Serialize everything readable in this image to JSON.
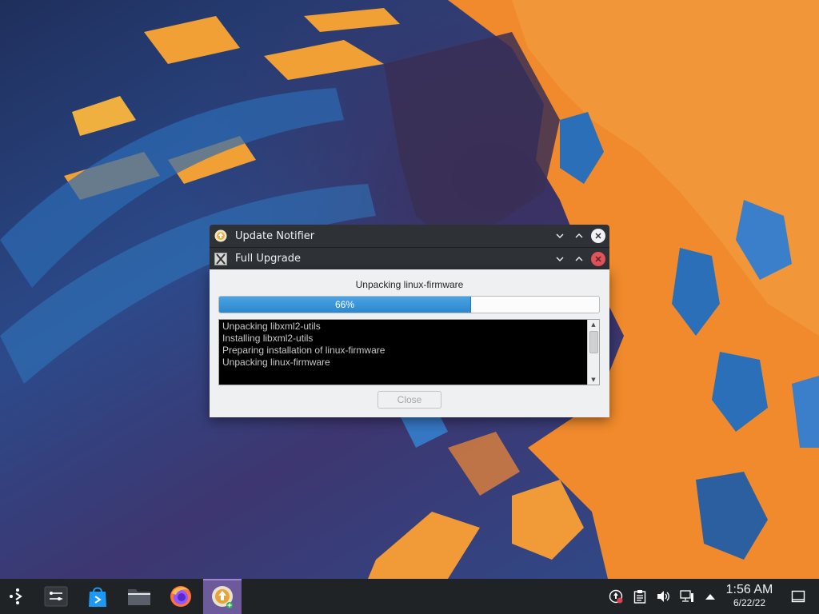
{
  "windows": {
    "notifier": {
      "title": "Update Notifier",
      "icon": "update-notifier-icon"
    },
    "upgrade": {
      "title": "Full Upgrade",
      "icon": "x-app-icon",
      "status": "Unpacking linux-firmware",
      "progress": 0.66,
      "progress_text": "66%",
      "log_lines": [
        "Unpacking libxml2-utils",
        "Installing libxml2-utils",
        "Preparing installation of linux-firmware",
        "Unpacking linux-firmware"
      ],
      "close_label": "Close",
      "close_enabled": false
    }
  },
  "taskbar": {
    "launchers": [
      {
        "name": "app-launcher-icon"
      },
      {
        "name": "system-settings-icon"
      },
      {
        "name": "discover-store-icon"
      },
      {
        "name": "file-manager-icon"
      },
      {
        "name": "firefox-icon"
      },
      {
        "name": "update-notifier-task-icon"
      }
    ],
    "tray": [
      "update-tray-icon",
      "clipboard-icon",
      "volume-icon",
      "network-icon",
      "tray-expand-icon"
    ],
    "clock": {
      "time": "1:56 AM",
      "date": "6/22/22"
    },
    "show_desktop": "show-desktop-icon"
  },
  "colors": {
    "accent": "#3daee9",
    "titlebar": "#2e3136",
    "panel": "#202326",
    "close_red": "#e2535a"
  }
}
